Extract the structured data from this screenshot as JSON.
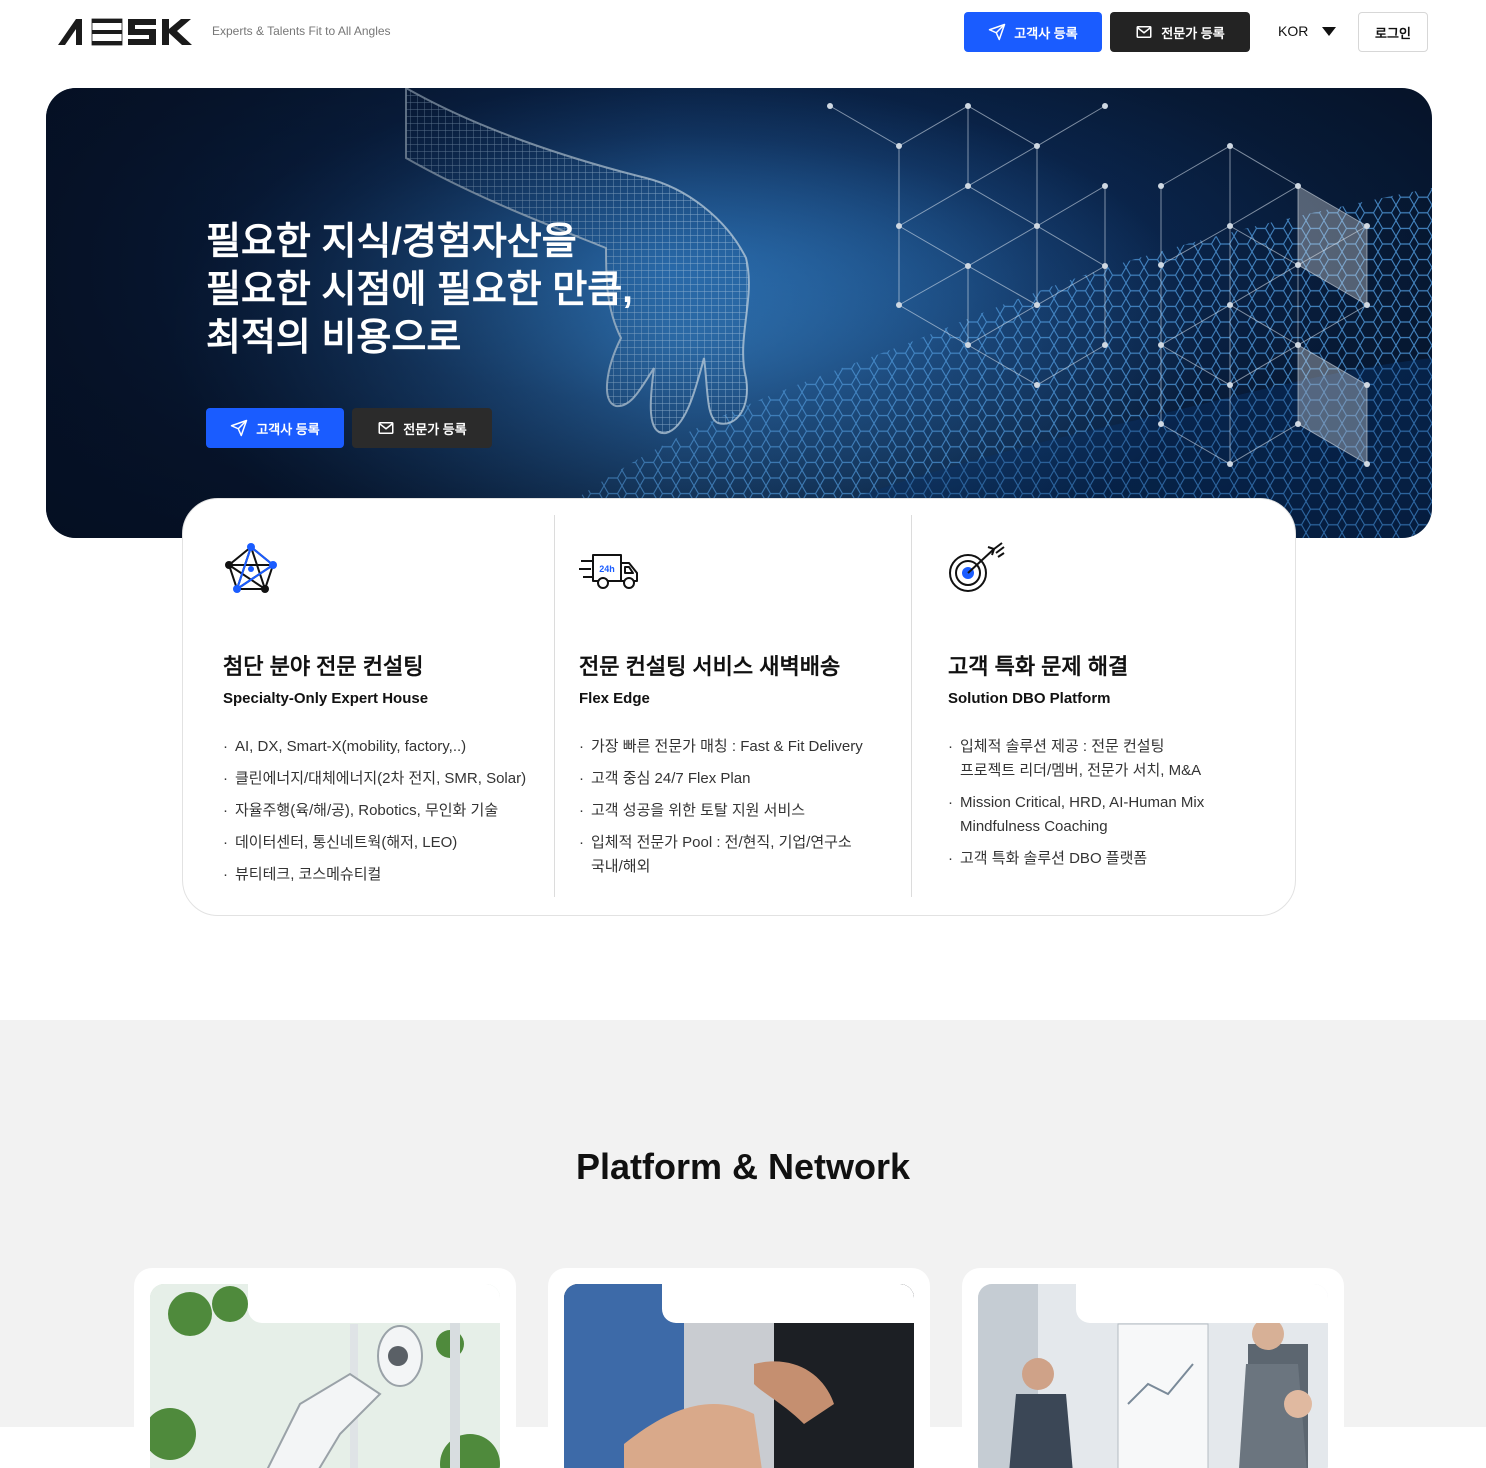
{
  "header": {
    "logo_text": "AESK",
    "tagline": "Experts & Talents Fit to All Angles",
    "client_register_label": "고객사 등록",
    "expert_register_label": "전문가 등록",
    "language": "KOR",
    "login_label": "로그인"
  },
  "hero": {
    "title_lines": [
      "필요한 지식/경험자산을",
      "필요한 시점에 필요한 만큼,",
      "최적의 비용으로"
    ],
    "client_register_label": "고객사 등록",
    "expert_register_label": "전문가 등록"
  },
  "features": [
    {
      "icon": "network-pentagon-icon",
      "title": "첨단 분야 전문 컨설팅",
      "subtitle": "Specialty-Only Expert House",
      "items": [
        [
          "AI, DX, Smart-X(mobility, factory,..)"
        ],
        [
          "클린에너지/대체에너지(2차 전지, SMR, Solar)"
        ],
        [
          "자율주행(육/해/공), Robotics, 무인화 기술"
        ],
        [
          "데이터센터, 통신네트웍(해저, LEO)"
        ],
        [
          "뷰티테크, 코스메슈티컬"
        ]
      ]
    },
    {
      "icon": "delivery-truck-24h-icon",
      "truck_badge": "24h",
      "title": "전문 컨설팅 서비스 새벽배송",
      "subtitle": "Flex Edge",
      "items": [
        [
          "가장 빠른 전문가 매칭 : Fast & Fit Delivery"
        ],
        [
          "고객 중심 24/7 Flex Plan"
        ],
        [
          "고객 성공을 위한 토탈 지원 서비스"
        ],
        [
          "입체적 전문가 Pool : 전/현직, 기업/연구소",
          "국내/해외"
        ]
      ]
    },
    {
      "icon": "target-arrow-icon",
      "title": "고객 특화 문제 해결",
      "subtitle": "Solution DBO Platform",
      "items": [
        [
          "입체적 솔루션 제공 : 전문 컨설팅",
          "프로젝트 리더/멤버, 전문가 서치, M&A"
        ],
        [
          "Mission Critical, HRD, AI-Human Mix",
          "Mindfulness Coaching"
        ],
        [
          "고객 특화 솔루션 DBO 플랫폼"
        ]
      ]
    }
  ],
  "platform": {
    "title": "Platform & Network",
    "cards": [
      {
        "image": "robot-arm-plants-photo"
      },
      {
        "image": "team-hands-meeting-photo"
      },
      {
        "image": "presentation-meeting-photo"
      }
    ]
  },
  "colors": {
    "accent": "#1a5cff",
    "dark_button": "#232323",
    "section_bg": "#f2f2f2"
  }
}
